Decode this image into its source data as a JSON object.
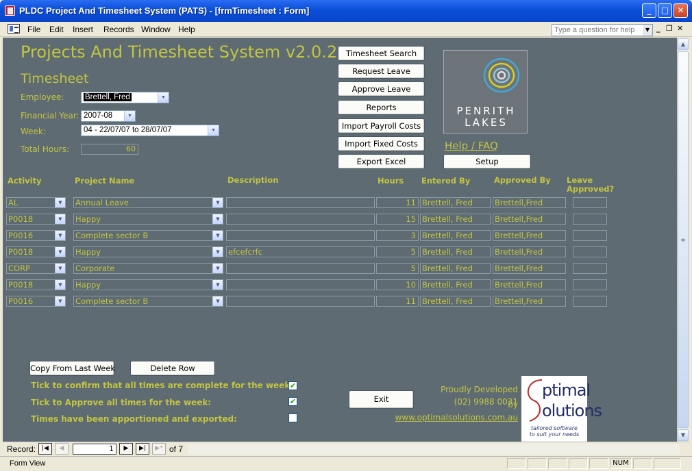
{
  "window": {
    "title": "PLDC Project And Timesheet System (PATS) - [frmTimesheet : Form]",
    "min": "_",
    "max": "□",
    "close": "✕"
  },
  "menu": {
    "items": [
      "File",
      "Edit",
      "Insert",
      "Records",
      "Window",
      "Help"
    ],
    "help_placeholder": "Type a question for help"
  },
  "form": {
    "app_title": "Projects And Timesheet System v2.0.2",
    "sub_title": "Timesheet",
    "employee_label": "Employee:",
    "employee_value": "Brettell, Fred",
    "fy_label": "Financial Year:",
    "fy_value": "2007-08",
    "week_label": "Week:",
    "week_value": "04  - 22/07/07 to 28/07/07",
    "total_hours_label": "Total Hours:",
    "total_hours_value": "60",
    "buttons": {
      "timesheet_search": "Timesheet Search",
      "request_leave": "Request Leave",
      "approve_leave": "Approve Leave",
      "reports": "Reports",
      "import_payroll": "Import Payroll Costs",
      "import_fixed": "Import Fixed Costs",
      "export_excel": "Export Excel",
      "setup": "Setup",
      "copy_last_week": "Copy From Last Week",
      "delete_row": "Delete Row",
      "exit": "Exit"
    },
    "logo_text_1": "PENRITH",
    "logo_text_2": "LAKES",
    "help_link": "Help / FAQ"
  },
  "grid": {
    "headers": {
      "activity": "Activity",
      "project": "Project Name",
      "description": "Description",
      "hours": "Hours",
      "entered_by": "Entered By",
      "approved_by": "Approved By",
      "leave_approved_1": "Leave",
      "leave_approved_2": "Approved?"
    },
    "rows": [
      {
        "activity": "AL",
        "project": "Annual Leave",
        "description": "",
        "hours": "11",
        "entered_by": "Brettell, Fred",
        "approved_by": "Brettell,Fred"
      },
      {
        "activity": "P0018",
        "project": "Happy",
        "description": "",
        "hours": "15",
        "entered_by": "Brettell, Fred",
        "approved_by": "Brettell,Fred"
      },
      {
        "activity": "P0016",
        "project": "Complete sector B",
        "description": "",
        "hours": "3",
        "entered_by": "Brettell, Fred",
        "approved_by": "Brettell,Fred"
      },
      {
        "activity": "P0018",
        "project": "Happy",
        "description": "efcefcrfc",
        "hours": "5",
        "entered_by": "Brettell, Fred",
        "approved_by": "Brettell,Fred"
      },
      {
        "activity": "CORP",
        "project": "Corporate",
        "description": "",
        "hours": "5",
        "entered_by": "Brettell, Fred",
        "approved_by": "Brettell,Fred"
      },
      {
        "activity": "P0018",
        "project": "Happy",
        "description": "",
        "hours": "10",
        "entered_by": "Brettell, Fred",
        "approved_by": "Brettell,Fred"
      },
      {
        "activity": "P0016",
        "project": "Complete sector B",
        "description": "",
        "hours": "11",
        "entered_by": "Brettell, Fred",
        "approved_by": "Brettell,Fred"
      }
    ]
  },
  "checks": {
    "confirm_label": "Tick to confirm that all times are complete for the week:",
    "confirm_checked": true,
    "approve_label": "Tick to Approve all times for the week:",
    "approve_checked": true,
    "exported_label": "Times have been apportioned and exported:",
    "exported_checked": false
  },
  "developer": {
    "proudly": "Proudly Developed by",
    "phone": "(02) 9988 0031",
    "url": "www.optimalsolutions.com.au",
    "logo_line1": "ptimal",
    "logo_line2": "olutions",
    "tagline_1": "tailored software",
    "tagline_2": "to suit your needs"
  },
  "record_nav": {
    "label": "Record:",
    "current": "1",
    "of_text": "of 7"
  },
  "status": {
    "text": "Form View",
    "num": "NUM"
  },
  "colors": {
    "form_bg": "#5f6b73",
    "accent_text": "#c2c540"
  }
}
